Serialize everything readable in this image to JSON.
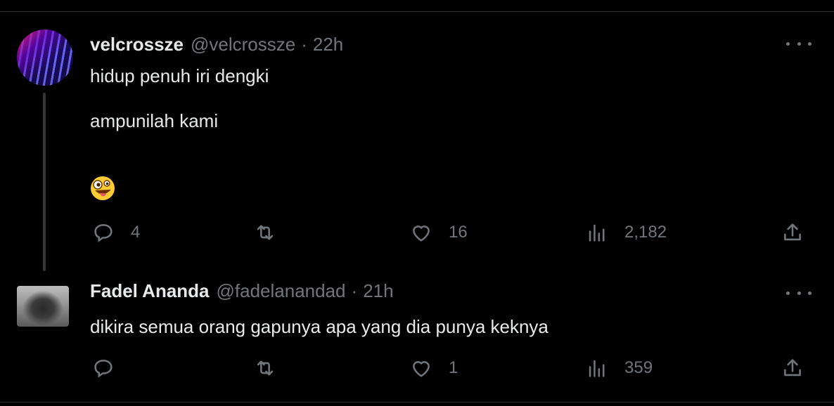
{
  "theme": {
    "background": "#000000",
    "text": "#e7e9ea",
    "muted": "#71767b",
    "divider": "#2f3336"
  },
  "tweets": [
    {
      "display_name": "velcrossze",
      "handle": "@velcrossze",
      "separator": "·",
      "time": "22h",
      "text": "hidup penuh iri dengki\n\nampunilah kami",
      "emoji": "zany-face",
      "reply_count": "4",
      "retweet_count": "",
      "like_count": "16",
      "view_count": "2,182"
    },
    {
      "display_name": "Fadel Ananda",
      "handle": "@fadelanandad",
      "separator": "·",
      "time": "21h",
      "text": "dikira semua orang gapunya apa yang dia punya keknya",
      "reply_count": "",
      "retweet_count": "",
      "like_count": "1",
      "view_count": "359"
    }
  ],
  "icons": {
    "reply": "speech-bubble-icon",
    "retweet": "retweet-arrows-icon",
    "like": "heart-icon",
    "views": "bar-chart-icon",
    "share": "upload-share-icon",
    "more": "ellipsis-icon"
  }
}
